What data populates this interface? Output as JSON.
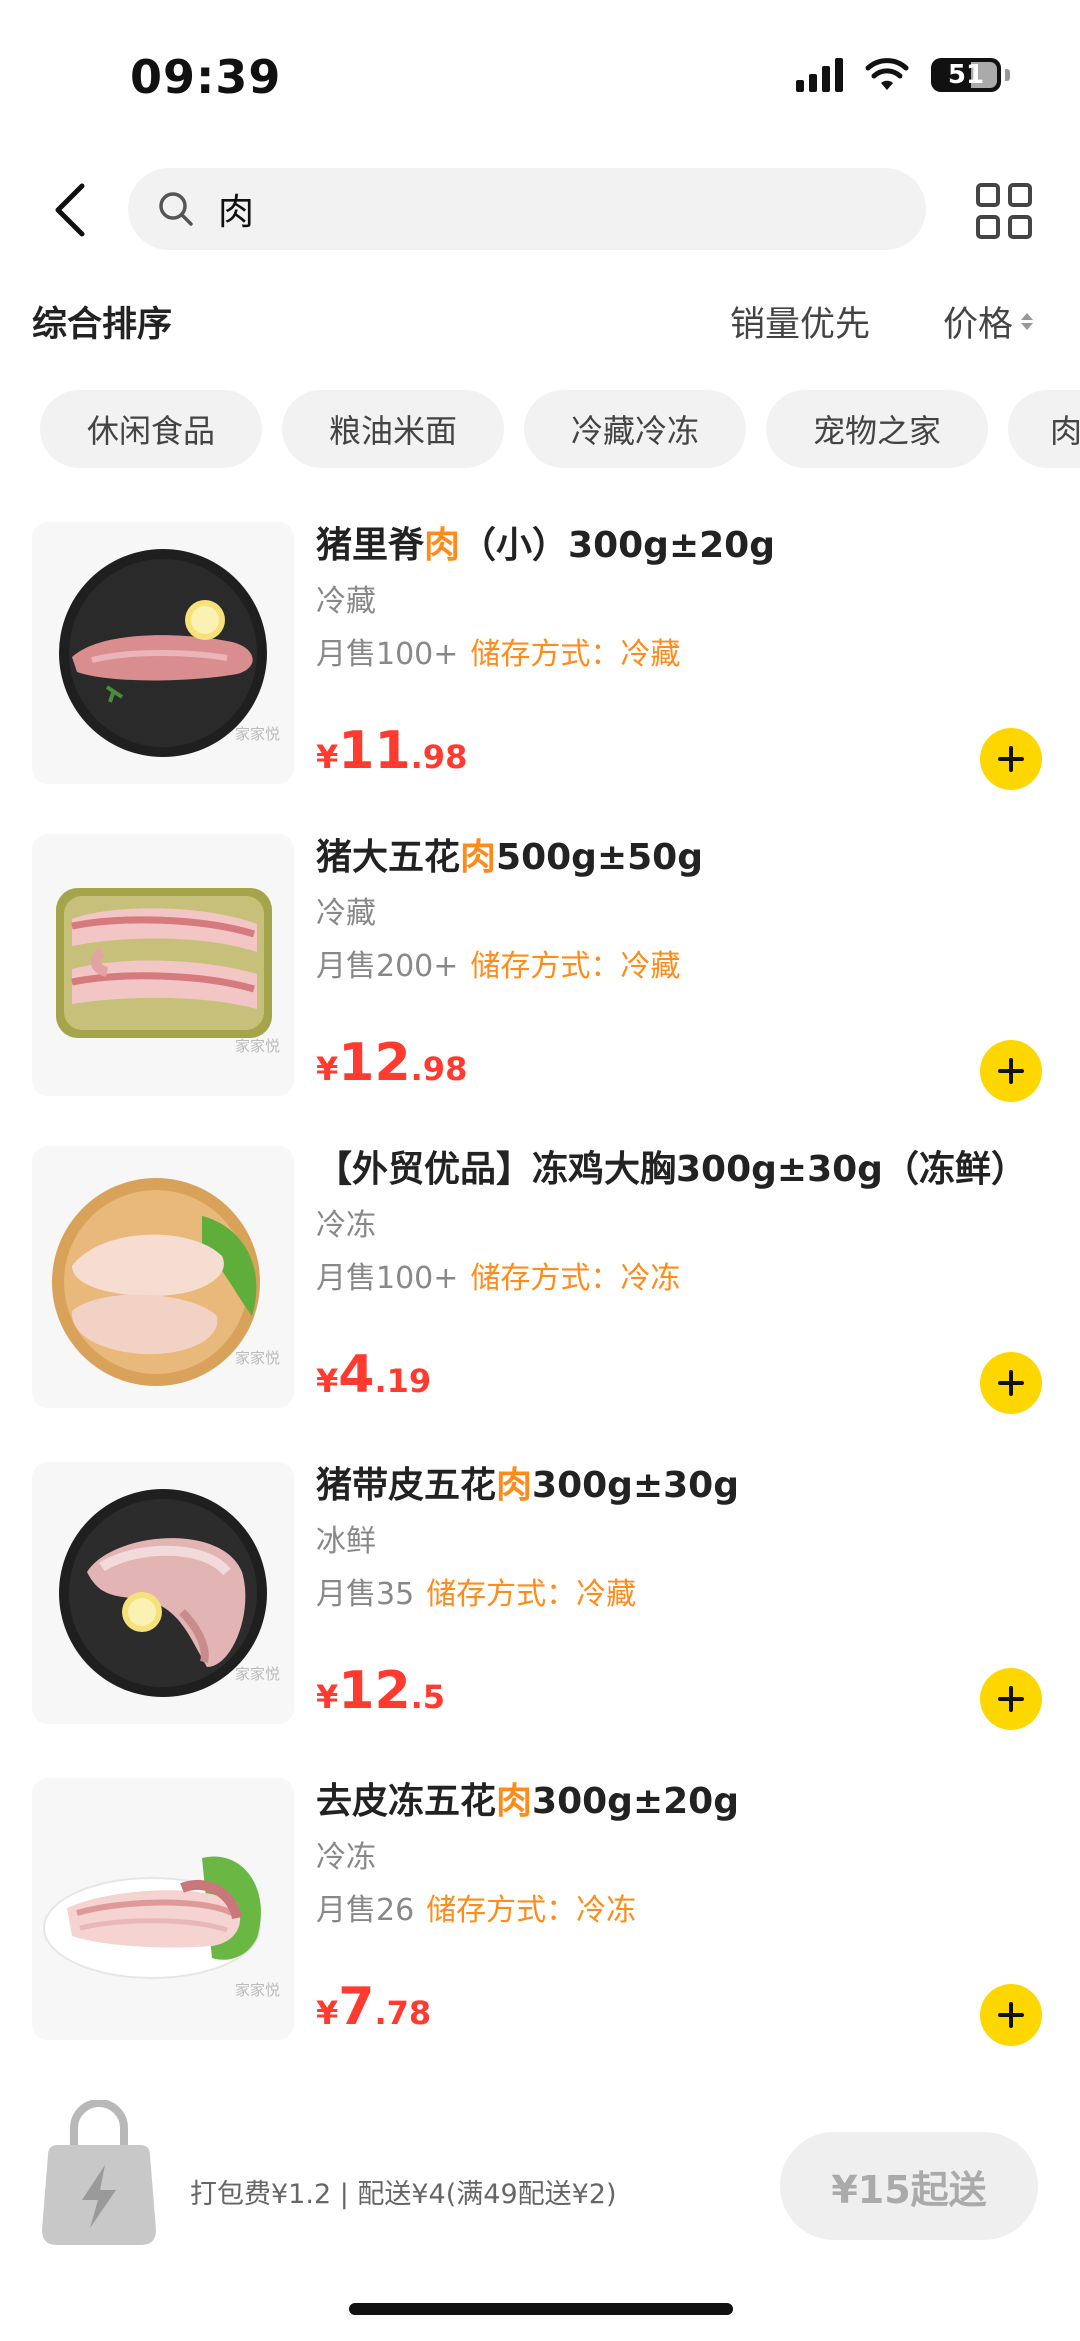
{
  "status": {
    "time": "09:39",
    "battery": "51"
  },
  "search": {
    "query": "肉"
  },
  "sort": {
    "main": "综合排序",
    "sales": "销量优先",
    "price": "价格"
  },
  "chips": [
    "休闲食品",
    "粮油米面",
    "冷藏冷冻",
    "宠物之家",
    "肉"
  ],
  "products": [
    {
      "title_before": "猪里脊",
      "title_hl": "肉",
      "title_after": "（小）300g±20g",
      "sub": "冷藏",
      "sales": "月售100+",
      "storage": "储存方式：冷藏",
      "yen": "¥",
      "price_int": "11",
      "price_dec": ".98",
      "watermark": "家家悦"
    },
    {
      "title_before": "猪大五花",
      "title_hl": "肉",
      "title_after": "500g±50g",
      "sub": "冷藏",
      "sales": "月售200+",
      "storage": "储存方式：冷藏",
      "yen": "¥",
      "price_int": "12",
      "price_dec": ".98",
      "watermark": "家家悦"
    },
    {
      "title_before": "【外贸优品】冻鸡大胸300g±30g（冻鲜）",
      "title_hl": "",
      "title_after": "",
      "sub": "冷冻",
      "sales": "月售100+",
      "storage": "储存方式：冷冻",
      "yen": "¥",
      "price_int": "4",
      "price_dec": ".19",
      "watermark": "家家悦"
    },
    {
      "title_before": "猪带皮五花",
      "title_hl": "肉",
      "title_after": "300g±30g",
      "sub": "冰鲜",
      "sales": "月售35",
      "storage": "储存方式：冷藏",
      "yen": "¥",
      "price_int": "12",
      "price_dec": ".5",
      "watermark": "家家悦"
    },
    {
      "title_before": "去皮冻五花",
      "title_hl": "肉",
      "title_after": "300g±20g",
      "sub": "冷冻",
      "sales": "月售26",
      "storage": "储存方式：冷冻",
      "yen": "¥",
      "price_int": "7",
      "price_dec": ".78",
      "watermark": "家家悦"
    }
  ],
  "cart": {
    "fee": "打包费¥1.2 | 配送¥4(满49配送¥2)",
    "checkout": "¥15起送"
  },
  "colors": {
    "accent": "#ff8c1a",
    "price": "#ff3b30",
    "add": "#ffd700"
  }
}
